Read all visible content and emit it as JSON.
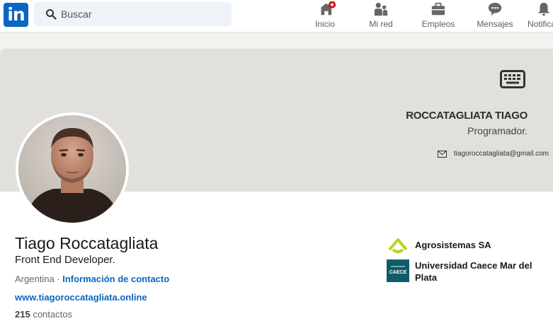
{
  "nav": {
    "logo_text": "in",
    "search_placeholder": "Buscar",
    "items": [
      {
        "label": "Inicio",
        "icon": "home-icon"
      },
      {
        "label": "Mi red",
        "icon": "network-icon"
      },
      {
        "label": "Empleos",
        "icon": "briefcase-icon"
      },
      {
        "label": "Mensajes",
        "icon": "message-icon"
      },
      {
        "label": "Notificac",
        "icon": "bell-icon"
      }
    ]
  },
  "banner": {
    "name": "ROCCATAGLIATA TIAGO",
    "role": "Programador.",
    "email": "tiagoroccatagliata@gmail.com"
  },
  "profile": {
    "name": "Tiago Roccatagliata",
    "headline": "Front End Developer.",
    "location": "Argentina",
    "separator": " · ",
    "contact_link": "Información de contacto",
    "website": "www.tiagoroccatagliata.online",
    "connections_count": "215",
    "connections_label": " contactos"
  },
  "experience": [
    {
      "name": "Agrosistemas SA"
    },
    {
      "name": "Universidad Caece Mar del Plata",
      "logo_text": "CAECE"
    }
  ],
  "colors": {
    "brand": "#0a66c2",
    "notification_dot": "#cc1016",
    "banner": "#e1e0dc",
    "agro_green": "#b5d31f",
    "caece_teal": "#0f5c69"
  }
}
